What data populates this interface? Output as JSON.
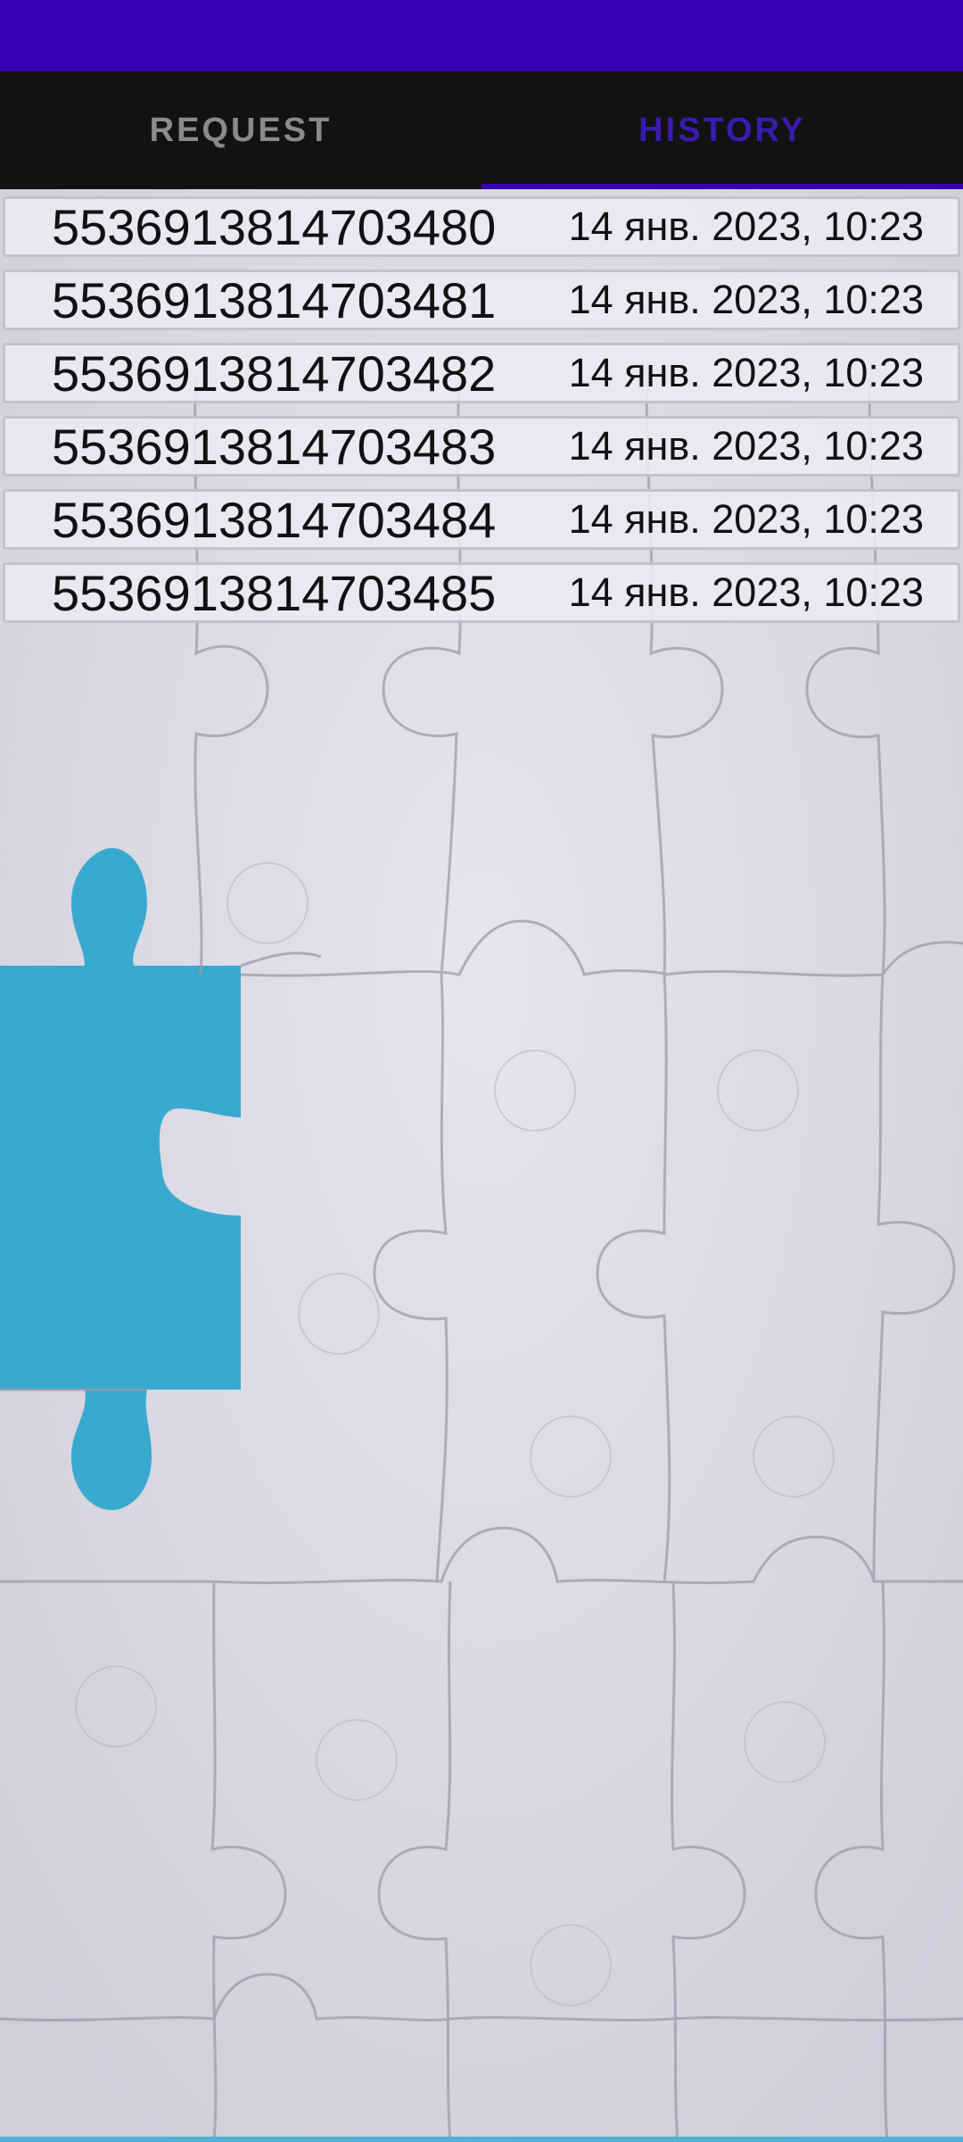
{
  "tabs": [
    {
      "label": "REQUEST",
      "active": false
    },
    {
      "label": "HISTORY",
      "active": true
    }
  ],
  "history": [
    {
      "number": "5536913814703480",
      "date": "14 янв. 2023, 10:23"
    },
    {
      "number": "5536913814703481",
      "date": "14 янв. 2023, 10:23"
    },
    {
      "number": "5536913814703482",
      "date": "14 янв. 2023, 10:23"
    },
    {
      "number": "5536913814703483",
      "date": "14 янв. 2023, 10:23"
    },
    {
      "number": "5536913814703484",
      "date": "14 янв. 2023, 10:23"
    },
    {
      "number": "5536913814703485",
      "date": "14 янв. 2023, 10:23"
    }
  ],
  "colors": {
    "status_bar": "#3700b3",
    "tab_bar": "#121212",
    "tab_active": "#3a1bb0",
    "tab_inactive": "#8a8a8a",
    "puzzle_background": "#d9d8e2",
    "puzzle_gap": "#3aa9cf"
  },
  "background_image": "puzzle-pieces-with-missing-piece"
}
